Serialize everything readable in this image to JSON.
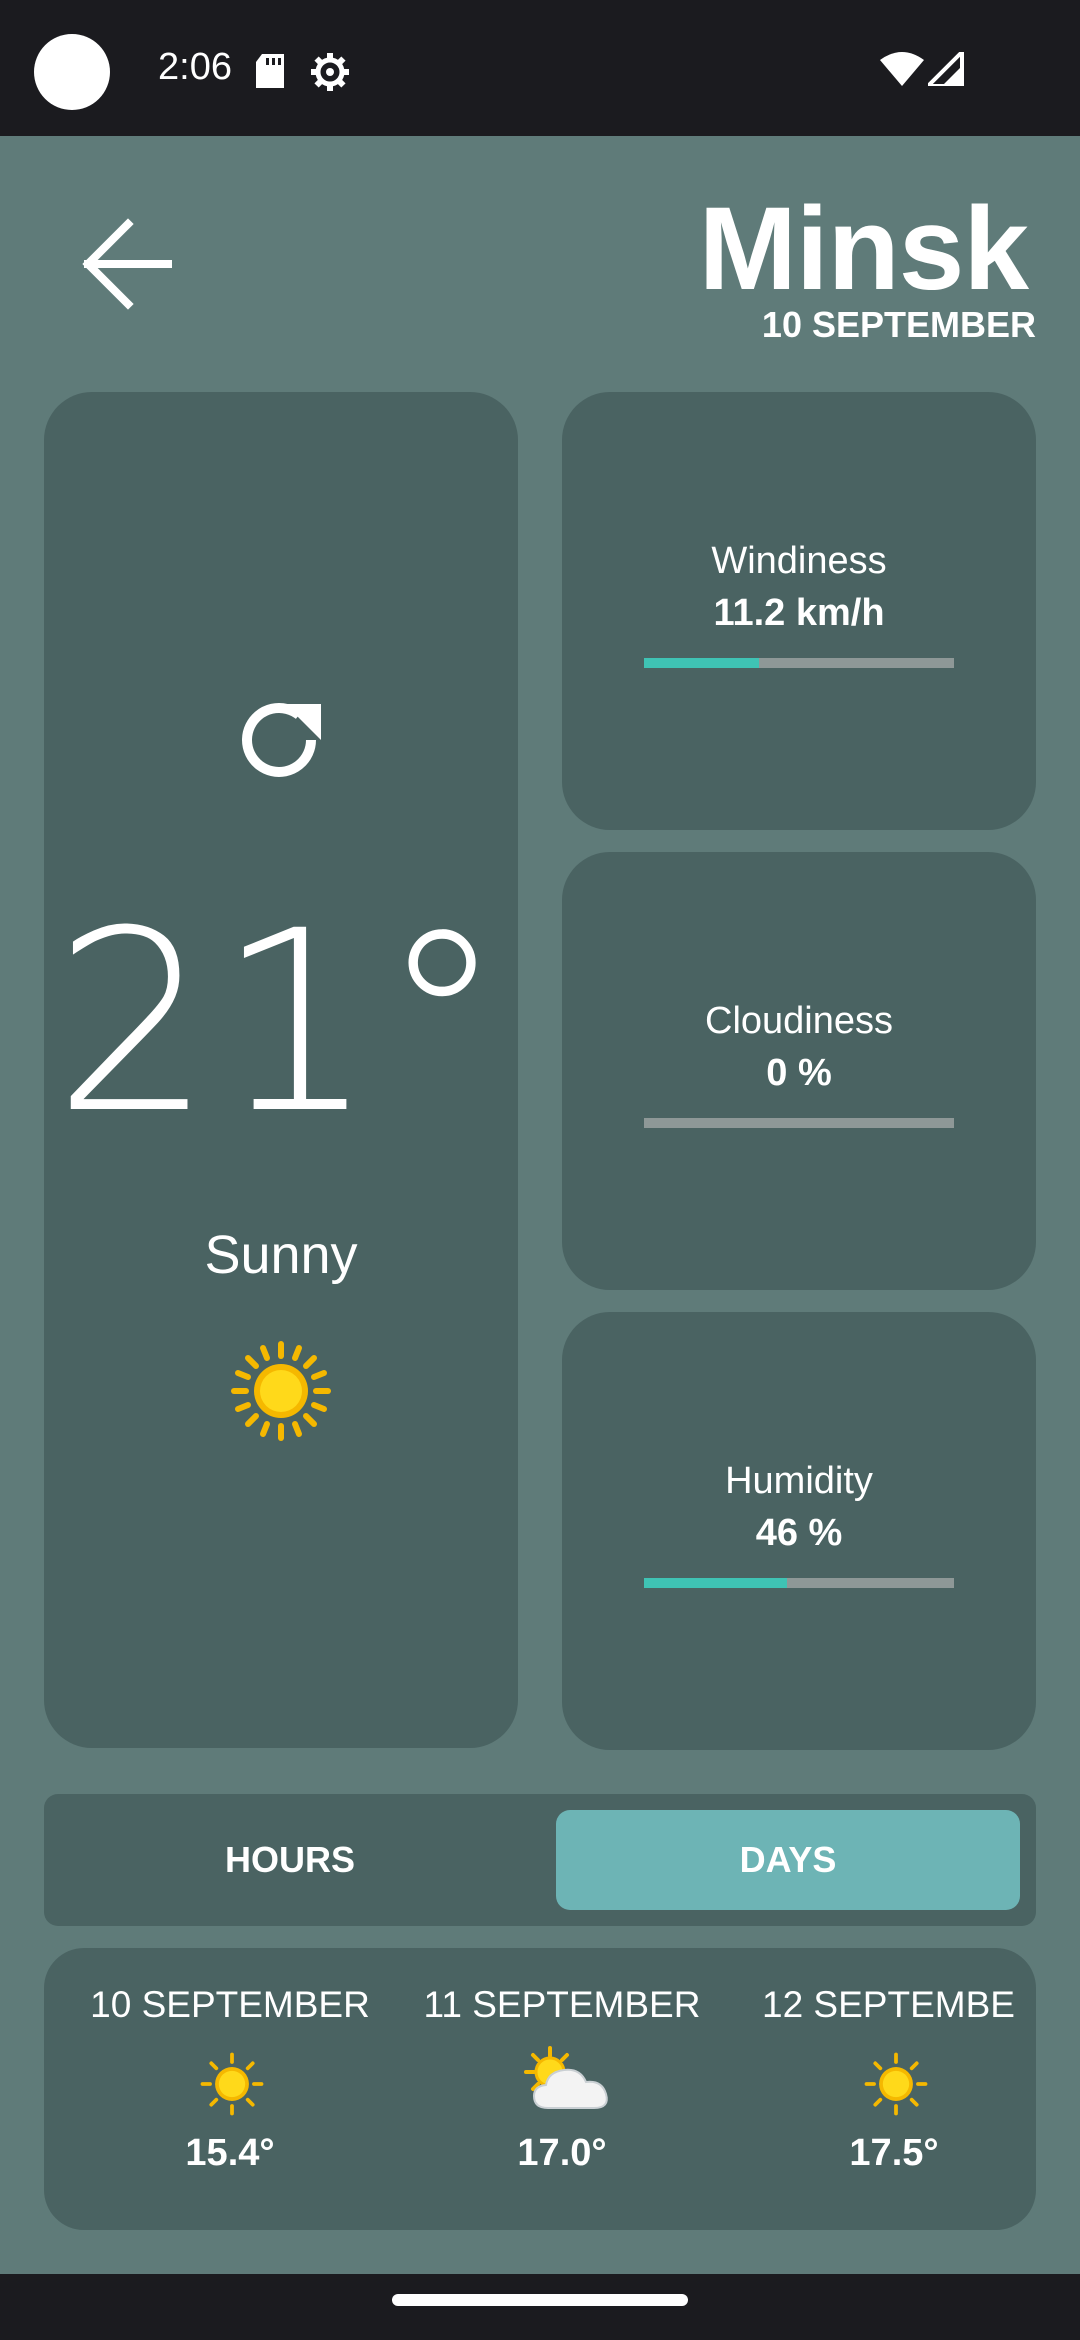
{
  "status_bar": {
    "time": "2:06",
    "icons": [
      "sd-card-icon",
      "gear-icon",
      "wifi-icon",
      "signal-icon"
    ]
  },
  "header": {
    "back_icon": "arrow-left-icon",
    "city": "Minsk",
    "date": "10 SEPTEMBER"
  },
  "current": {
    "refresh_icon": "refresh-icon",
    "temperature": "21°",
    "condition": "Sunny",
    "condition_icon": "sun-icon"
  },
  "stats": [
    {
      "label": "Windiness",
      "value": "11.2 km/h",
      "level": 0.37
    },
    {
      "label": "Cloudiness",
      "value": "0 %",
      "level": 0.0
    },
    {
      "label": "Humidity",
      "value": "46 %",
      "level": 0.46
    }
  ],
  "tabs": {
    "hours": "HOURS",
    "days": "DAYS",
    "selected": "days"
  },
  "forecast": [
    {
      "date": "10 SEPTEMBER",
      "icon": "sun-icon",
      "temp": "15.4°"
    },
    {
      "date": "11 SEPTEMBER",
      "icon": "sun-behind-cloud-icon",
      "temp": "17.0°"
    },
    {
      "date": "12 SEPTEMBE",
      "icon": "sun-icon",
      "temp": "17.5°"
    }
  ],
  "colors": {
    "background": "#5f7b79",
    "card": "#4a6362",
    "accent": "#3fc3b4",
    "selected_tab": "#6db4b5",
    "system_bar": "#1b1b1f"
  }
}
